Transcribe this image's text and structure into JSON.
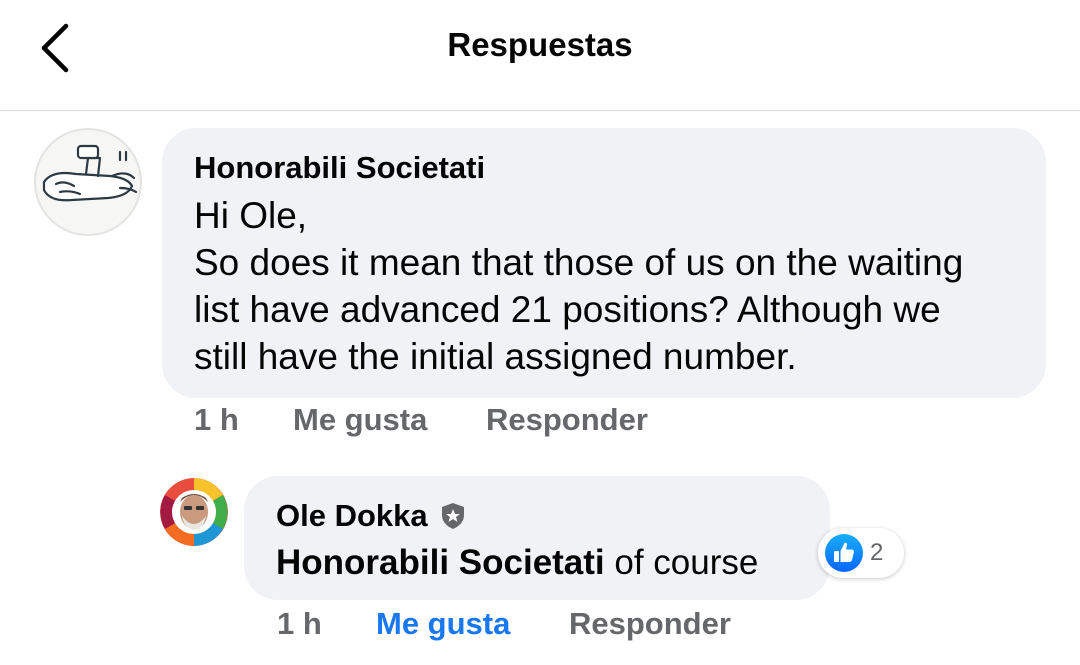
{
  "header": {
    "title": "Respuestas",
    "back_icon": "chevron-left-icon"
  },
  "comment": {
    "author": "Honorabili Societati",
    "lines": [
      "Hi Ole,",
      "So does it mean that those of us on the waiting",
      "list have advanced 21 positions? Although we",
      "still have the initial assigned number."
    ],
    "time": "1 h",
    "like_label": "Me gusta",
    "reply_label": "Responder",
    "avatar_icon": "cartoon-avatar-icon"
  },
  "reply": {
    "author": "Ole Dokka",
    "badge_icon": "top-fan-shield-icon",
    "mention": "Honorabili Societati",
    "text": " of course",
    "time": "1 h",
    "like_label": "Me gusta",
    "reply_label": "Responder",
    "liked": true,
    "reaction": {
      "icon": "thumbs-up-reaction-icon",
      "count": "2"
    },
    "avatar_icon": "profile-photo-avatar"
  },
  "colors": {
    "accent": "#1877f2",
    "bubble": "#f0f2f5",
    "secondary_text": "#65676b"
  }
}
